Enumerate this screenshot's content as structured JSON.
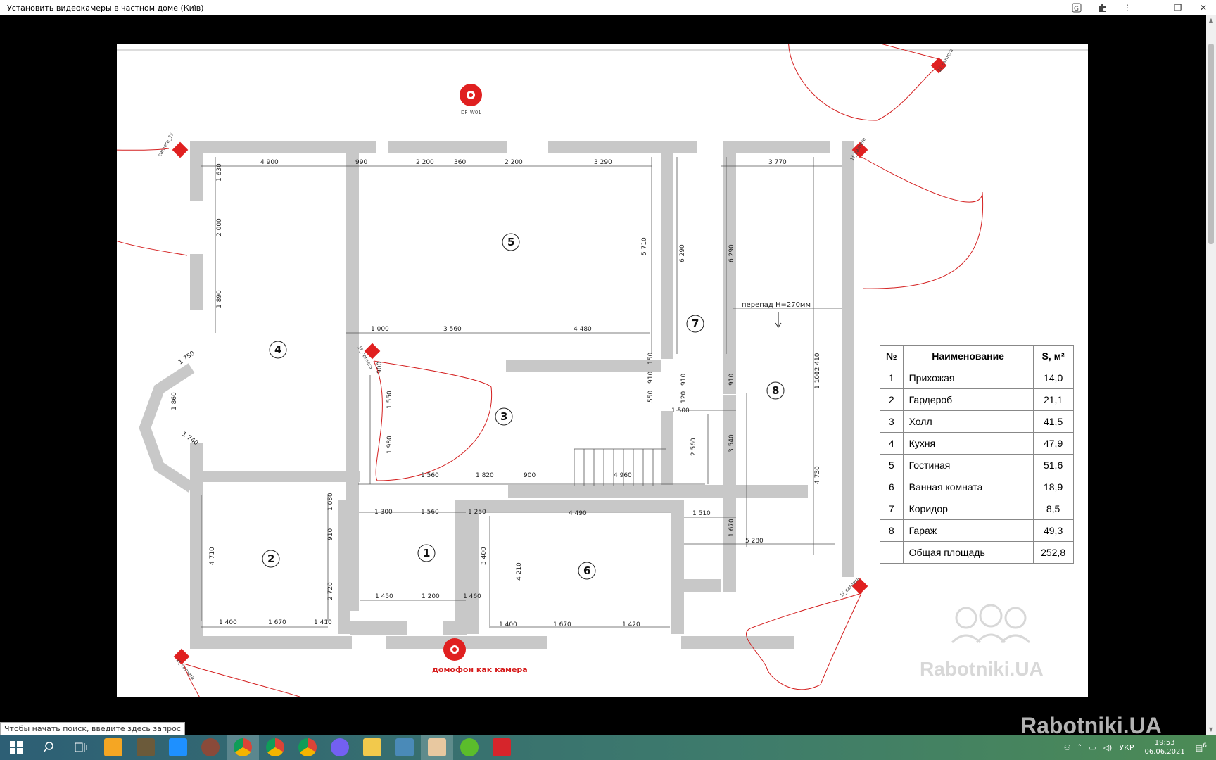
{
  "window": {
    "title": "Установить видеокамеры в частном доме (Київ)"
  },
  "plan": {
    "rooms": [
      {
        "num": "1"
      },
      {
        "num": "2"
      },
      {
        "num": "3"
      },
      {
        "num": "4"
      },
      {
        "num": "5"
      },
      {
        "num": "6"
      },
      {
        "num": "7"
      },
      {
        "num": "8"
      }
    ],
    "dims": [
      "4 900",
      "990",
      "2 200",
      "360",
      "2 200",
      "3 290",
      "3 770",
      "1 630",
      "2 000",
      "1 890",
      "1 750",
      "1 860",
      "1 740",
      "5 710",
      "6 290",
      "6 290",
      "1 000",
      "3 560",
      "4 480",
      "900",
      "1 550",
      "1 980",
      "910",
      "150",
      "910",
      "550",
      "120",
      "1 500",
      "910",
      "2 560",
      "3 540",
      "12 410",
      "1 100",
      "4 730",
      "1 560",
      "1 820",
      "900",
      "4 960",
      "1 080",
      "910",
      "1 300",
      "1 560",
      "1 250",
      "3 400",
      "4 710",
      "2 720",
      "4 490",
      "4 210",
      "1 510",
      "1 670",
      "5 280",
      "1 450",
      "1 200",
      "1 460",
      "1 400",
      "1 670",
      "1 410",
      "1 400",
      "1 670",
      "1 420"
    ],
    "level_note": "перепад Н=270мм",
    "intercom_label": "домофон как камера",
    "camera_top_label": "DF_W01",
    "camera_labels": [
      "camera_1f",
      "1f_camera",
      "1f_camera",
      "1f_camera",
      "1f_camera",
      "1f_camera"
    ]
  },
  "legend": {
    "headers": [
      "№",
      "Наименование",
      "S, м²"
    ],
    "rows": [
      {
        "n": "1",
        "name": "Прихожая",
        "s": "14,0"
      },
      {
        "n": "2",
        "name": "Гардероб",
        "s": "21,1"
      },
      {
        "n": "3",
        "name": "Холл",
        "s": "41,5"
      },
      {
        "n": "4",
        "name": "Кухня",
        "s": "47,9"
      },
      {
        "n": "5",
        "name": "Гостиная",
        "s": "51,6"
      },
      {
        "n": "6",
        "name": "Ванная комната",
        "s": "18,9"
      },
      {
        "n": "7",
        "name": "Коридор",
        "s": "8,5"
      },
      {
        "n": "8",
        "name": "Гараж",
        "s": "49,3"
      },
      {
        "n": "",
        "name": "Общая площадь",
        "s": "252,8"
      }
    ]
  },
  "watermark": {
    "text_small": "Rabotniki.UA",
    "text_large": "Rabotniki.UA"
  },
  "taskbar": {
    "search_tip": "Чтобы начать поиск, введите здесь запрос",
    "lang": "УКР",
    "time": "19:53",
    "date": "06.06.2021",
    "notif_count": "6",
    "apps": [
      "start-icon",
      "search-icon",
      "task-view-icon",
      "store-icon",
      "game-icon",
      "photos-icon",
      "avatar-app-icon",
      "chrome-icon",
      "chrome-canary-icon",
      "chrome-alt-icon",
      "viber-icon",
      "folder-icon",
      "image-viewer-icon",
      "user-app-icon",
      "utorrent-icon",
      "red-app-icon"
    ]
  },
  "colors": {
    "wall": "#c8c8c8",
    "camera": "#e02020",
    "annotation": "#d42020",
    "taskbar": "#2d5f75"
  }
}
